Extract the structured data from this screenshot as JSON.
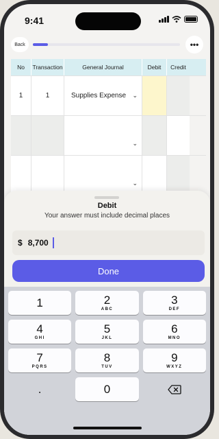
{
  "status": {
    "time": "9:41"
  },
  "topbar": {
    "back_label": "Back",
    "more_label": "•••",
    "progress_fraction": 0.1
  },
  "table": {
    "headers": [
      "No",
      "Transaction",
      "General Journal",
      "Debit",
      "Credit"
    ],
    "rows": [
      {
        "no": "1",
        "transaction": "1",
        "account": "Supplies Expense",
        "debit": "",
        "credit": ""
      },
      {
        "no": "",
        "transaction": "",
        "account": "",
        "debit": "",
        "credit": ""
      },
      {
        "no": "",
        "transaction": "",
        "account": "",
        "debit": "",
        "credit": ""
      }
    ],
    "chevron": "⌄"
  },
  "sheet": {
    "title": "Debit",
    "subtitle": "Your answer must include decimal places",
    "currency": "$",
    "value": "8,700",
    "done_label": "Done"
  },
  "keypad": {
    "keys": [
      [
        {
          "n": "1",
          "l": ""
        },
        {
          "n": "2",
          "l": "ABC"
        },
        {
          "n": "3",
          "l": "DEF"
        }
      ],
      [
        {
          "n": "4",
          "l": "GHI"
        },
        {
          "n": "5",
          "l": "JKL"
        },
        {
          "n": "6",
          "l": "MNO"
        }
      ],
      [
        {
          "n": "7",
          "l": "PQRS"
        },
        {
          "n": "8",
          "l": "TUV"
        },
        {
          "n": "9",
          "l": "WXYZ"
        }
      ]
    ],
    "decimal": ".",
    "zero": "0",
    "delete_icon": "delete-icon"
  },
  "colors": {
    "accent": "#5b5ce6",
    "header": "#d7eef2",
    "active_cell": "#fdf6cc"
  }
}
